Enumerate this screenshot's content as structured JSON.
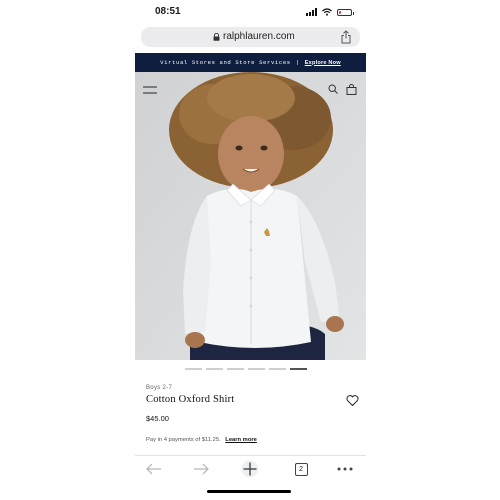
{
  "status_bar": {
    "time": "08:51",
    "battery_level": 0.2,
    "battery_color": "#e53935"
  },
  "browser": {
    "url": "ralphlauren.com",
    "tab_count": "2"
  },
  "promo_banner": {
    "text": "Virtual Stores and Store Services",
    "separator": "|",
    "link": "Explore Now",
    "background": "#0f1d3f"
  },
  "hero": {
    "image": "boy-in-white-oxford-shirt",
    "slide_count": 6,
    "active_slide": 6
  },
  "product": {
    "category": "Boys 2-7",
    "name": "Cotton Oxford Shirt",
    "price": "$45.00",
    "installments_text": "Pay in 4 payments of $11.25.",
    "learn_more": "Learn more"
  },
  "icons": {
    "menu": "hamburger-icon",
    "search": "search-icon",
    "bag": "shopping-bag-icon",
    "wishlist": "heart-icon",
    "share": "share-icon",
    "lock": "lock-icon",
    "back": "back-arrow-icon",
    "forward": "forward-arrow-icon",
    "new_tab": "plus-icon",
    "more": "more-dots-icon"
  }
}
